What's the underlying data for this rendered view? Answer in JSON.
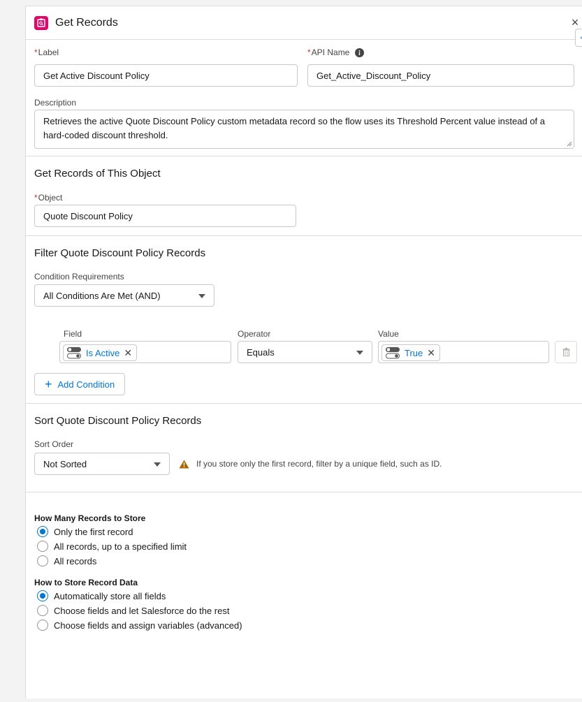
{
  "header": {
    "title": "Get Records",
    "close": "×"
  },
  "general": {
    "label_label": "Label",
    "label_value": "Get Active Discount Policy",
    "api_label": "API Name",
    "api_value": "Get_Active_Discount_Policy",
    "description_label": "Description",
    "description_value": "Retrieves the active Quote Discount Policy custom metadata record so the flow uses its Threshold Percent value instead of a hard-coded discount threshold."
  },
  "object_section": {
    "title": "Get Records of This Object",
    "object_label": "Object",
    "object_value": "Quote Discount Policy"
  },
  "filter_section": {
    "title": "Filter Quote Discount Policy Records",
    "condition_label": "Condition Requirements",
    "condition_value": "All Conditions Are Met (AND)",
    "field_col": "Field",
    "operator_col": "Operator",
    "value_col": "Value",
    "field_pill": "Is Active",
    "operator_value": "Equals",
    "value_pill": "True",
    "add_condition": "Add Condition"
  },
  "sort_section": {
    "title": "Sort Quote Discount Policy Records",
    "sort_label": "Sort Order",
    "sort_value": "Not Sorted",
    "warning": "If you store only the first record, filter by a unique field, such as ID."
  },
  "store_section": {
    "how_many_title": "How Many Records to Store",
    "how_many_options": [
      "Only the first record",
      "All records, up to a specified limit",
      "All records"
    ],
    "how_many_selected": 0,
    "how_store_title": "How to Store Record Data",
    "how_store_options": [
      "Automatically store all fields",
      "Choose fields and let Salesforce do the rest",
      "Choose fields and assign variables (advanced)"
    ],
    "how_store_selected": 0
  },
  "colors": {
    "accent": "#0176d3",
    "header_icon": "#e3066a",
    "warning": "#a96404",
    "required": "#c23934"
  }
}
